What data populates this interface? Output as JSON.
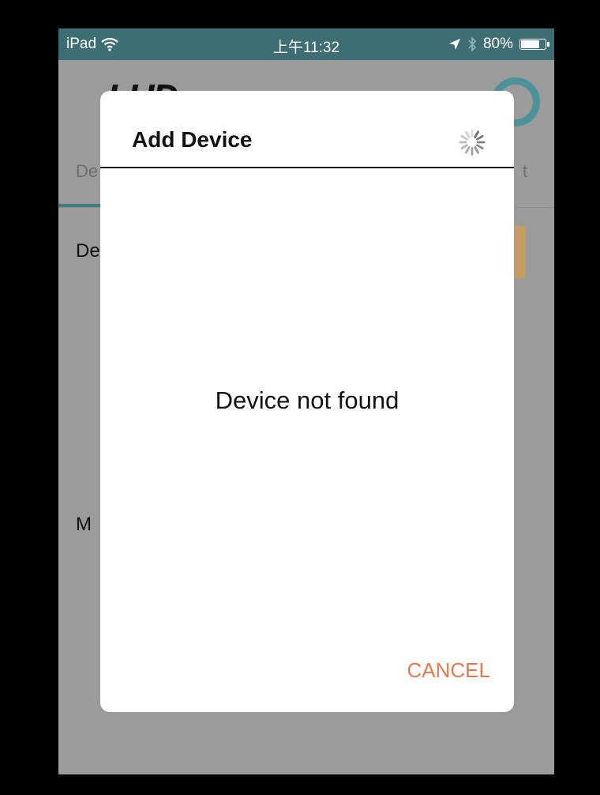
{
  "status_bar": {
    "device": "iPad",
    "time": "上午11:32",
    "battery_percent_text": "80%",
    "battery_level": 0.8,
    "icons": [
      "wifi-icon",
      "location-arrow-icon",
      "bluetooth-icon",
      "battery-icon"
    ]
  },
  "background_app": {
    "tab_left_label": "De",
    "tab_right_label": "t",
    "row1_label": "De",
    "row2_label": "M",
    "accent_color": "#3f7d83"
  },
  "dialog": {
    "title": "Add Device",
    "message": "Device not found",
    "cancel_label": "CANCEL",
    "cancel_color": "#e07b54",
    "icons": [
      "loading-spinner-icon"
    ]
  }
}
